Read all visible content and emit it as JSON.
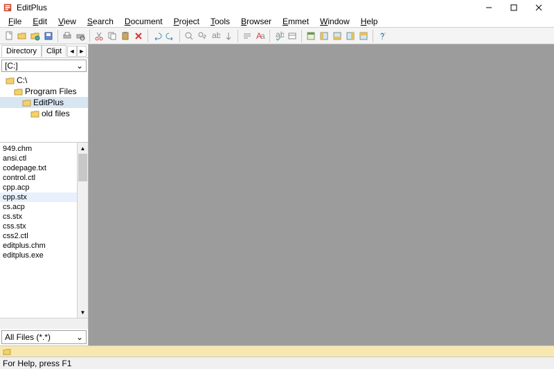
{
  "title": "EditPlus",
  "menus": [
    "File",
    "Edit",
    "View",
    "Search",
    "Document",
    "Project",
    "Tools",
    "Browser",
    "Emmet",
    "Window",
    "Help"
  ],
  "sidebar": {
    "tabs": [
      "Directory",
      "Clipt"
    ],
    "active_tab": 0,
    "drive": "[C:]",
    "tree": [
      {
        "label": "C:\\",
        "indent": 0,
        "sel": false
      },
      {
        "label": "Program Files",
        "indent": 1,
        "sel": false
      },
      {
        "label": "EditPlus",
        "indent": 2,
        "sel": true
      },
      {
        "label": "old files",
        "indent": 3,
        "sel": false
      }
    ],
    "files": [
      "949.chm",
      "ansi.ctl",
      "codepage.txt",
      "control.ctl",
      "cpp.acp",
      "cpp.stx",
      "cs.acp",
      "cs.stx",
      "css.stx",
      "css2.ctl",
      "editplus.chm",
      "editplus.exe"
    ],
    "selected_file": "cpp.stx",
    "filter": "All Files (*.*)"
  },
  "status": "For Help, press F1"
}
